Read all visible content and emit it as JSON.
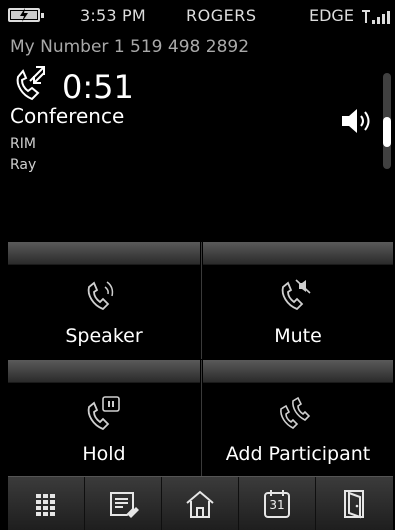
{
  "status": {
    "time": "3:53 PM",
    "carrier": "ROGERS",
    "network": "EDGE",
    "battery_icon": "battery-charging-icon",
    "signal_icon": "signal-strength-icon"
  },
  "my_number": "My Number  1 519 498 2892",
  "call": {
    "icon": "conference-call-icon",
    "duration": "0:51",
    "name": "Conference",
    "participants": [
      "RIM",
      "Ray"
    ],
    "volume_icon": "speaker-volume-icon"
  },
  "actions": [
    {
      "label": "Speaker",
      "icon": "speakerphone-icon"
    },
    {
      "label": "Mute",
      "icon": "mute-icon"
    },
    {
      "label": "Hold",
      "icon": "hold-icon"
    },
    {
      "label": "Add Participant",
      "icon": "add-participant-icon"
    }
  ],
  "dock": [
    {
      "name": "dialpad",
      "icon": "dialpad-grid-icon"
    },
    {
      "name": "notes",
      "icon": "notes-icon"
    },
    {
      "name": "home",
      "icon": "home-icon"
    },
    {
      "name": "calendar",
      "icon": "calendar-icon",
      "text": "31"
    },
    {
      "name": "exit",
      "icon": "exit-door-icon"
    }
  ]
}
